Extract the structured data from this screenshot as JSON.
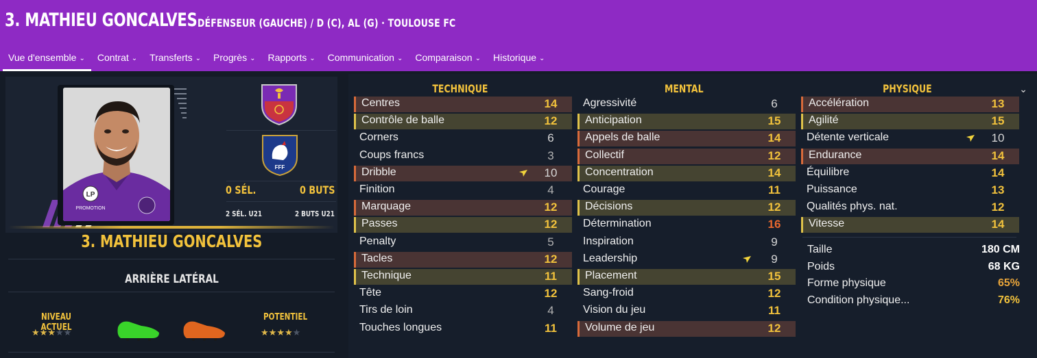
{
  "header": {
    "title": "3. MATHIEU GONCALVES",
    "subtitle": "DÉFENSEUR (GAUCHE) / D (C), AL (G) · TOULOUSE FC",
    "tabs": [
      {
        "label": "Vue d'ensemble"
      },
      {
        "label": "Contrat"
      },
      {
        "label": "Transferts"
      },
      {
        "label": "Progrès"
      },
      {
        "label": "Rapports"
      },
      {
        "label": "Communication"
      },
      {
        "label": "Comparaison"
      },
      {
        "label": "Historique"
      }
    ],
    "active_tab": "Vue d'ensemble"
  },
  "profile": {
    "name": "3. MATHIEU GONCALVES",
    "role": "ARRIÈRE LATÉRAL",
    "caps": "0 SÉL.",
    "goals": "0 BUTS",
    "caps_u21": "2 SÉL. U21",
    "goals_u21": "2 BUTS U21",
    "current_ability_label": "NIVEAU ACTUEL",
    "potential_ability_label": "POTENTIEL",
    "current_ability_stars": 2.5,
    "potential_ability_stars": 3.5,
    "star_total": 5,
    "kit_sponsor": "PROMOTION",
    "kit_logo": "LP",
    "nation_badge_text": "FFF",
    "club_badge_icon": "toulouse-fc-crest-icon",
    "nation_badge_icon": "fff-rooster-crest-icon",
    "left_boot_color": "#39d32a",
    "right_boot_color": "#e0661f"
  },
  "attributes": {
    "technical": {
      "heading": "TECHNIQUE",
      "items": [
        {
          "label": "Centres",
          "value": "14",
          "style": "yellow",
          "hl": "orange"
        },
        {
          "label": "Contrôle de balle",
          "value": "12",
          "style": "yellow",
          "hl": "yellow"
        },
        {
          "label": "Corners",
          "value": "6",
          "style": "light",
          "hl": ""
        },
        {
          "label": "Coups francs",
          "value": "3",
          "style": "gray",
          "hl": ""
        },
        {
          "label": "Dribble",
          "value": "10",
          "style": "light",
          "hl": "orange",
          "arrow": true
        },
        {
          "label": "Finition",
          "value": "4",
          "style": "gray",
          "hl": ""
        },
        {
          "label": "Marquage",
          "value": "12",
          "style": "yellow",
          "hl": "orange"
        },
        {
          "label": "Passes",
          "value": "12",
          "style": "yellow",
          "hl": "yellow"
        },
        {
          "label": "Penalty",
          "value": "5",
          "style": "gray",
          "hl": ""
        },
        {
          "label": "Tacles",
          "value": "12",
          "style": "yellow",
          "hl": "orange"
        },
        {
          "label": "Technique",
          "value": "11",
          "style": "yellow",
          "hl": "yellow"
        },
        {
          "label": "Tête",
          "value": "12",
          "style": "yellow",
          "hl": ""
        },
        {
          "label": "Tirs de loin",
          "value": "4",
          "style": "gray",
          "hl": ""
        },
        {
          "label": "Touches longues",
          "value": "11",
          "style": "yellow",
          "hl": ""
        }
      ]
    },
    "mental": {
      "heading": "MENTAL",
      "items": [
        {
          "label": "Agressivité",
          "value": "6",
          "style": "light",
          "hl": ""
        },
        {
          "label": "Anticipation",
          "value": "15",
          "style": "yellow",
          "hl": "yellow"
        },
        {
          "label": "Appels de balle",
          "value": "14",
          "style": "yellow",
          "hl": "orange"
        },
        {
          "label": "Collectif",
          "value": "12",
          "style": "yellow",
          "hl": "orange"
        },
        {
          "label": "Concentration",
          "value": "14",
          "style": "yellow",
          "hl": "yellow"
        },
        {
          "label": "Courage",
          "value": "11",
          "style": "yellow",
          "hl": ""
        },
        {
          "label": "Décisions",
          "value": "12",
          "style": "yellow",
          "hl": "yellow"
        },
        {
          "label": "Détermination",
          "value": "16",
          "style": "orange",
          "hl": ""
        },
        {
          "label": "Inspiration",
          "value": "9",
          "style": "light",
          "hl": ""
        },
        {
          "label": "Leadership",
          "value": "9",
          "style": "light",
          "hl": "",
          "arrow": true
        },
        {
          "label": "Placement",
          "value": "15",
          "style": "yellow",
          "hl": "yellow"
        },
        {
          "label": "Sang-froid",
          "value": "12",
          "style": "yellow",
          "hl": ""
        },
        {
          "label": "Vision du jeu",
          "value": "11",
          "style": "yellow",
          "hl": ""
        },
        {
          "label": "Volume de jeu",
          "value": "12",
          "style": "yellow",
          "hl": "orange"
        }
      ]
    },
    "physical": {
      "heading": "PHYSIQUE",
      "items": [
        {
          "label": "Accélération",
          "value": "13",
          "style": "yellow",
          "hl": "orange"
        },
        {
          "label": "Agilité",
          "value": "15",
          "style": "yellow",
          "hl": "yellow"
        },
        {
          "label": "Détente verticale",
          "value": "10",
          "style": "light",
          "hl": "",
          "arrow": true
        },
        {
          "label": "Endurance",
          "value": "14",
          "style": "yellow",
          "hl": "orange"
        },
        {
          "label": "Équilibre",
          "value": "14",
          "style": "yellow",
          "hl": ""
        },
        {
          "label": "Puissance",
          "value": "13",
          "style": "yellow",
          "hl": ""
        },
        {
          "label": "Qualités phys. nat.",
          "value": "12",
          "style": "yellow",
          "hl": ""
        },
        {
          "label": "Vitesse",
          "value": "14",
          "style": "yellow",
          "hl": "yellow"
        }
      ],
      "details": [
        {
          "label": "Taille",
          "value": "180 CM",
          "style": "white"
        },
        {
          "label": "Poids",
          "value": "68 KG",
          "style": "white"
        },
        {
          "label": "Forme physique",
          "value": "65%",
          "style": "orange"
        },
        {
          "label": "Condition physique...",
          "value": "76%",
          "style": "yellow"
        }
      ]
    }
  },
  "colors": {
    "header_bg": "#8e2ac4",
    "page_bg": "#141b26",
    "accent_yellow": "#f2c23c",
    "accent_orange": "#e9682e"
  }
}
